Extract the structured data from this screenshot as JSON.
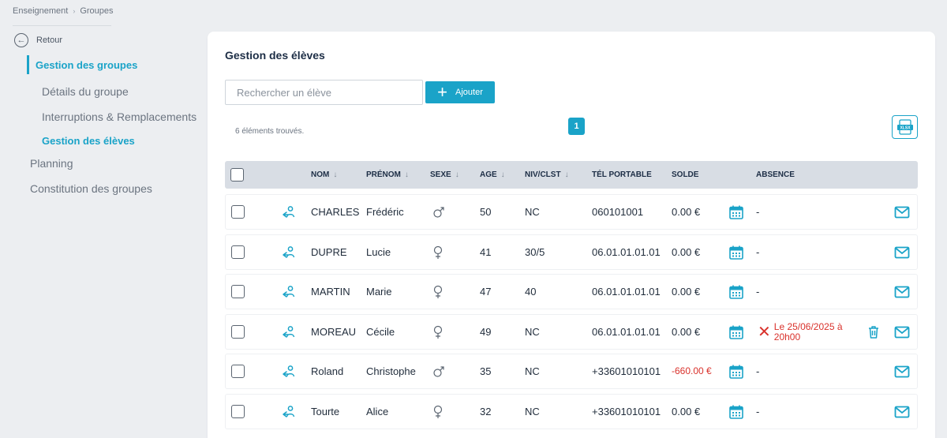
{
  "breadcrumb": {
    "items": [
      "Enseignement",
      "Groupes"
    ],
    "separator": "›"
  },
  "sidebar": {
    "back_label": "Retour",
    "section_title": "Gestion des groupes",
    "sub_items": [
      "Détails du groupe",
      "Interruptions & Remplacements",
      "Gestion des élèves"
    ],
    "active_sub_index": 2,
    "top_items": [
      "Planning",
      "Constitution des groupes"
    ]
  },
  "main": {
    "title": "Gestion des élèves",
    "search_placeholder": "Rechercher un élève",
    "add_label": "Ajouter",
    "results_count": "6 éléments trouvés.",
    "current_page": "1",
    "export_icon": "xlsx-export-icon"
  },
  "table": {
    "headers": {
      "nom": "NOM",
      "prenom": "PRÉNOM",
      "sexe": "SEXE",
      "age": "AGE",
      "niv": "NIV/CLST",
      "tel": "TÉL PORTABLE",
      "solde": "SOLDE",
      "absence": "ABSENCE"
    },
    "rows": [
      {
        "nom": "CHARLES",
        "prenom": "Frédéric",
        "sexe": "male",
        "age": "50",
        "niv": "NC",
        "tel": "060101001",
        "solde": "0.00 €",
        "solde_negative": false,
        "absence": "-",
        "absence_flag": false
      },
      {
        "nom": "DUPRE",
        "prenom": "Lucie",
        "sexe": "female",
        "age": "41",
        "niv": "30/5",
        "tel": "06.01.01.01.01",
        "solde": "0.00 €",
        "solde_negative": false,
        "absence": "-",
        "absence_flag": false
      },
      {
        "nom": "MARTIN",
        "prenom": "Marie",
        "sexe": "female",
        "age": "47",
        "niv": "40",
        "tel": "06.01.01.01.01",
        "solde": "0.00 €",
        "solde_negative": false,
        "absence": "-",
        "absence_flag": false
      },
      {
        "nom": "MOREAU",
        "prenom": "Cécile",
        "sexe": "female",
        "age": "49",
        "niv": "NC",
        "tel": "06.01.01.01.01",
        "solde": "0.00 €",
        "solde_negative": false,
        "absence": "Le 25/06/2025 à 20h00",
        "absence_flag": true
      },
      {
        "nom": "Roland",
        "prenom": "Christophe",
        "sexe": "male",
        "age": "35",
        "niv": "NC",
        "tel": "+33601010101",
        "solde": "-660.00 €",
        "solde_negative": true,
        "absence": "-",
        "absence_flag": false
      },
      {
        "nom": "Tourte",
        "prenom": "Alice",
        "sexe": "female",
        "age": "32",
        "niv": "NC",
        "tel": "+33601010101",
        "solde": "0.00 €",
        "solde_negative": false,
        "absence": "-",
        "absence_flag": false
      }
    ]
  },
  "colors": {
    "accent": "#1aa3c8",
    "danger": "#d9312b",
    "header_bg": "#d8dde4"
  }
}
